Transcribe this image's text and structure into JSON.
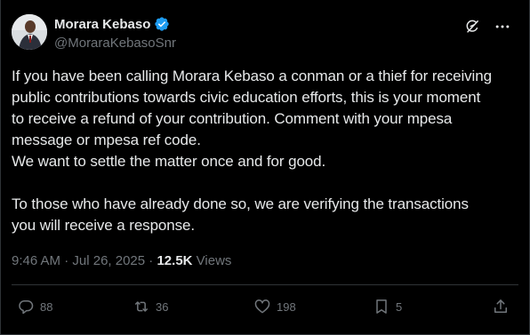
{
  "author": {
    "display_name": "Morara Kebaso",
    "handle": "@MoraraKebasoSnr",
    "verified": true
  },
  "icons": {
    "verified": "verified-badge-icon",
    "grok": "grok-icon",
    "more": "more-icon",
    "reply": "reply-icon",
    "repost": "repost-icon",
    "like": "heart-icon",
    "bookmark": "bookmark-icon",
    "share": "share-icon"
  },
  "tweet": {
    "lines": [
      "If you have been calling Morara Kebaso a conman or a thief for receiving",
      "public contributions towards civic education efforts, this is your moment",
      "to receive a refund of your contribution. Comment with your mpesa",
      "message or mpesa ref code.",
      "We want to settle the matter once and for good."
    ],
    "lines_2": [
      "To those who have already done so, we are verifying the transactions",
      "you will receive a response."
    ]
  },
  "meta": {
    "time": "9:46 AM",
    "separator": " · ",
    "date": "Jul 26, 2025",
    "dot": " · ",
    "views_count": "12.5K",
    "views_label": " Views"
  },
  "actions": {
    "replies": "88",
    "reposts": "36",
    "likes": "198",
    "bookmarks": "5"
  },
  "colors": {
    "background": "#000000",
    "text": "#e7e9ea",
    "muted": "#71767b",
    "verified_blue": "#1d9bf0",
    "border": "#2f3336"
  }
}
